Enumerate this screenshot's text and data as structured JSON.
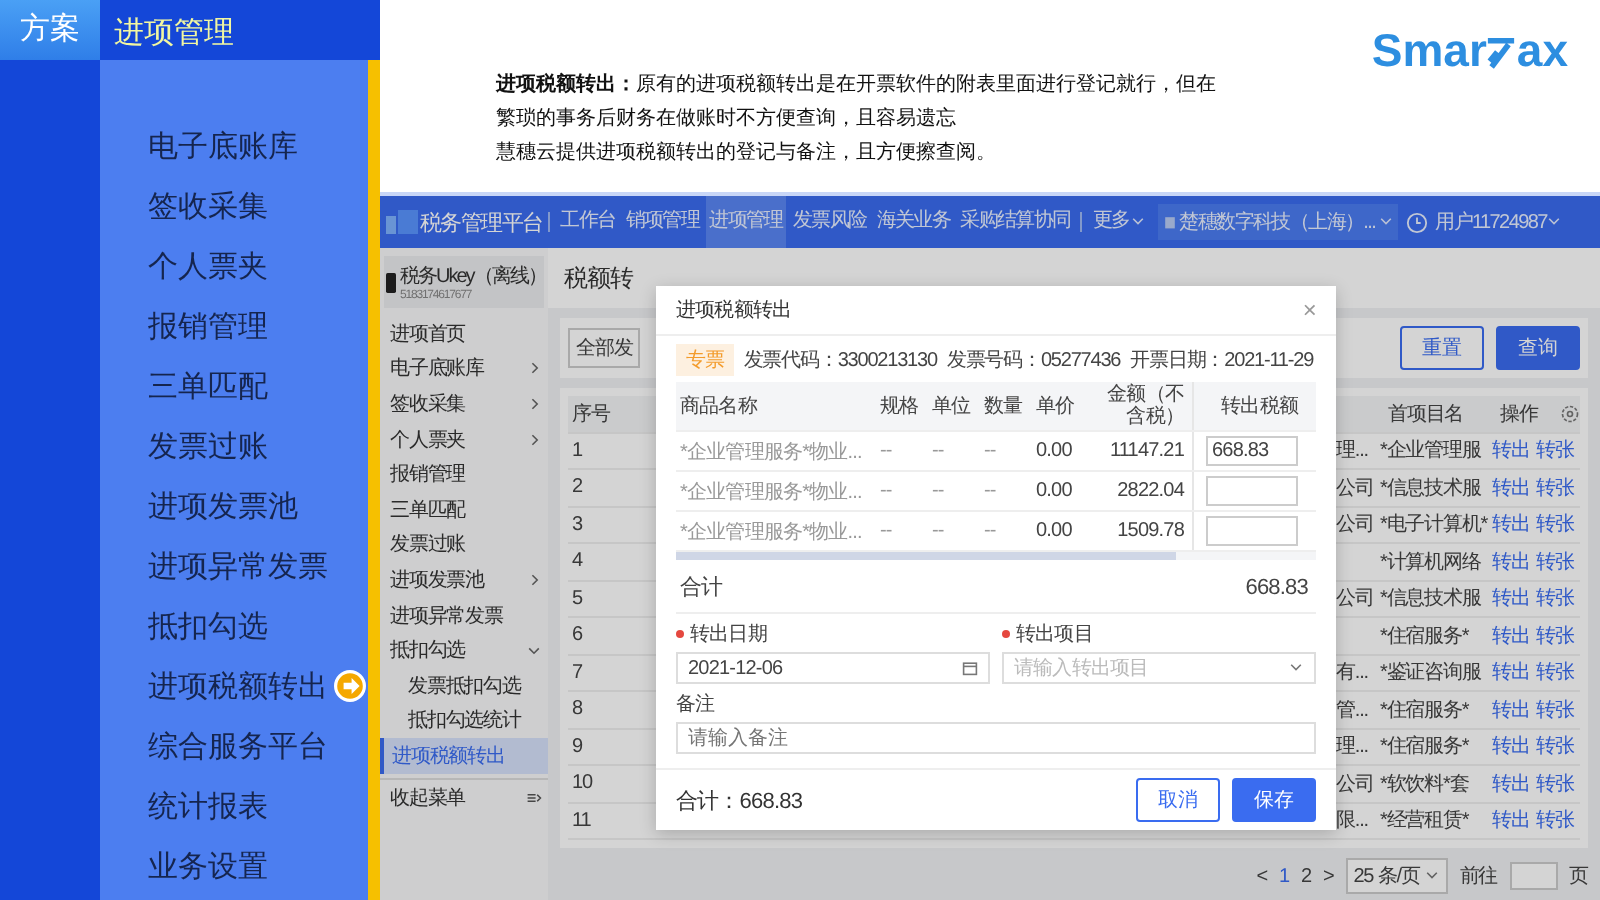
{
  "slide": {
    "tab": "方案",
    "section": "进项管理",
    "menu": [
      {
        "label": "电子底账库",
        "selected": false
      },
      {
        "label": "签收采集",
        "selected": false
      },
      {
        "label": "个人票夹",
        "selected": false
      },
      {
        "label": "报销管理",
        "selected": false
      },
      {
        "label": "三单匹配",
        "selected": false
      },
      {
        "label": "发票过账",
        "selected": false
      },
      {
        "label": "进项发票池",
        "selected": false
      },
      {
        "label": "进项异常发票",
        "selected": false
      },
      {
        "label": "抵扣勾选",
        "selected": false
      },
      {
        "label": "进项税额转出",
        "selected": true
      },
      {
        "label": "综合服务平台",
        "selected": false
      },
      {
        "label": "统计报表",
        "selected": false
      },
      {
        "label": "业务设置",
        "selected": false
      }
    ]
  },
  "description": {
    "lines": [
      "**进项税额转出：**原有的进项税额转出是在开票软件的附表里面进行登记就行，但在",
      "繁琐的事务后财务在做账时不方便查询，且容易遗忘",
      "慧穗云提供进项税额转出的登记与备注，且方便擦查阅。"
    ]
  },
  "logo": {
    "left": "Smar",
    "right": "ax"
  },
  "app": {
    "header": {
      "brand": "税务管理平台",
      "nav": [
        {
          "label": "工作台",
          "selected": false
        },
        {
          "label": "销项管理",
          "selected": false
        },
        {
          "label": "进项管理",
          "selected": true
        },
        {
          "label": "发票风险",
          "selected": false
        },
        {
          "label": "海关业务",
          "selected": false
        },
        {
          "label": "采购结算协同",
          "selected": false
        }
      ],
      "more": "更多",
      "company": "楚穗数字科技（上海）...",
      "user": "用户11724987"
    },
    "sidebar": {
      "device": {
        "name": "税务Ukey（离线）",
        "id": "5183174617677"
      },
      "items": [
        {
          "label": "进项首页",
          "kind": "link",
          "selected": false
        },
        {
          "label": "电子底账库",
          "kind": "group",
          "selected": false,
          "expanded": false
        },
        {
          "label": "签收采集",
          "kind": "group",
          "selected": false,
          "expanded": false
        },
        {
          "label": "个人票夹",
          "kind": "group",
          "selected": false,
          "expanded": false
        },
        {
          "label": "报销管理",
          "kind": "link",
          "selected": false
        },
        {
          "label": "三单匹配",
          "kind": "link",
          "selected": false
        },
        {
          "label": "发票过账",
          "kind": "link",
          "selected": false
        },
        {
          "label": "进项发票池",
          "kind": "group",
          "selected": false,
          "expanded": false
        },
        {
          "label": "进项异常发票",
          "kind": "link",
          "selected": false
        },
        {
          "label": "抵扣勾选",
          "kind": "group",
          "selected": false,
          "expanded": true,
          "children": [
            {
              "label": "发票抵扣勾选",
              "selected": false
            },
            {
              "label": "抵扣勾选统计",
              "selected": false
            }
          ]
        },
        {
          "label": "进项税额转出",
          "kind": "link",
          "selected": true
        }
      ],
      "collapse": "收起菜单"
    },
    "page": {
      "title": "税额转",
      "filter": "全部发",
      "reset": "重置",
      "search": "查询"
    },
    "table": {
      "index_header": "序号",
      "item_header": "首项目名",
      "action_header": "操作",
      "rows": [
        {
          "index": "1",
          "col_a": "理...",
          "item": "*企业管理服",
          "action_1": "转出",
          "action_2": "转张"
        },
        {
          "index": "2",
          "col_a": "公司",
          "item": "*信息技术服",
          "action_1": "转出",
          "action_2": "转张"
        },
        {
          "index": "3",
          "col_a": "公司",
          "item": "*电子计算机*",
          "action_1": "转出",
          "action_2": "转张"
        },
        {
          "index": "4",
          "item": "*计算机网络",
          "action_1": "转出",
          "action_2": "转张"
        },
        {
          "index": "5",
          "col_a": "公司",
          "item": "*信息技术服",
          "action_1": "转出",
          "action_2": "转张"
        },
        {
          "index": "6",
          "item": "*住宿服务*",
          "action_1": "转出",
          "action_2": "转张"
        },
        {
          "index": "7",
          "col_a": "有...",
          "item": "*鉴证咨询服",
          "action_1": "转出",
          "action_2": "转张"
        },
        {
          "index": "8",
          "col_a": "管...",
          "item": "*住宿服务*",
          "action_1": "转出",
          "action_2": "转张"
        },
        {
          "index": "9",
          "col_a": "理...",
          "item": "*住宿服务*",
          "action_1": "转出",
          "action_2": "转张"
        },
        {
          "index": "10",
          "col_a": "公司",
          "item": "*软饮料*套",
          "action_1": "转出",
          "action_2": "转张"
        },
        {
          "index": "11",
          "col_a": "限...",
          "item": "*经营租赁*",
          "action_1": "转出",
          "action_2": "转张"
        }
      ]
    },
    "pagination": {
      "prev": "<",
      "pages": [
        {
          "label": "1",
          "selected": true
        },
        {
          "label": "2",
          "selected": false
        }
      ],
      "next": ">",
      "size": "25 条/页",
      "goto": "前往",
      "unit": "页"
    },
    "modal": {
      "title": "进项税额转出",
      "close": "×",
      "tag": "专票",
      "meta": [
        "发票代码：3300213130",
        "发票号码：05277436",
        "开票日期：2021-11-29"
      ],
      "columns": [
        "商品名称",
        "规格",
        "单位",
        "数量",
        "单价",
        "金额（不含税）",
        "转出税额"
      ],
      "rows": [
        {
          "name": "*企业管理服务*物业...",
          "spec": "--",
          "unit": "--",
          "qty": "--",
          "price": "0.00",
          "amount": "11147.21",
          "out": "668.83"
        },
        {
          "name": "*企业管理服务*物业...",
          "spec": "--",
          "unit": "--",
          "qty": "--",
          "price": "0.00",
          "amount": "2822.04"
        },
        {
          "name": "*企业管理服务*物业...",
          "spec": "--",
          "unit": "--",
          "qty": "--",
          "price": "0.00",
          "amount": "1509.78"
        }
      ],
      "total_label": "合计",
      "total": "668.83",
      "fields": [
        {
          "kind": "date",
          "label": "转出日期",
          "required": true,
          "value": "2021-12-06"
        },
        {
          "kind": "select",
          "label": "转出项目",
          "required": true,
          "placeholder": "请输入转出项目"
        },
        {
          "kind": "text",
          "label": "备注",
          "required": false,
          "placeholder": "请输入备注"
        }
      ],
      "footer_total": "合计：668.83",
      "cancel": "取消",
      "save": "保存"
    }
  }
}
